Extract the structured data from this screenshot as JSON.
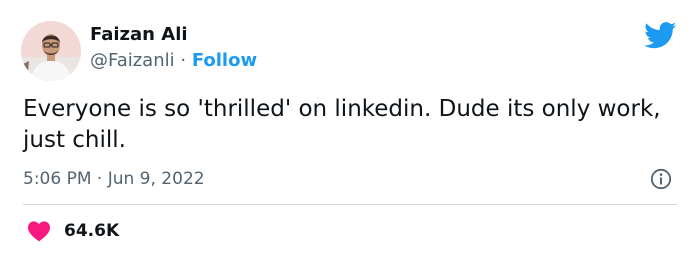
{
  "author": {
    "name": "Faizan Ali",
    "handle": "@Faizanli",
    "separator": "·",
    "follow_label": "Follow"
  },
  "tweet": {
    "text": "Everyone is so 'thrilled' on linkedin. Dude its only work, just chill.",
    "time": "5:06 PM",
    "separator": "·",
    "date": "Jun 9, 2022"
  },
  "engagement": {
    "likes": "64.6K"
  },
  "icons": {
    "logo": "twitter-bird-icon",
    "info": "info-icon",
    "like": "heart-icon"
  },
  "colors": {
    "accent": "#1d9bf0",
    "like": "#f91880",
    "muted": "#536471",
    "text": "#0f1419",
    "divider": "#cfd9de"
  }
}
